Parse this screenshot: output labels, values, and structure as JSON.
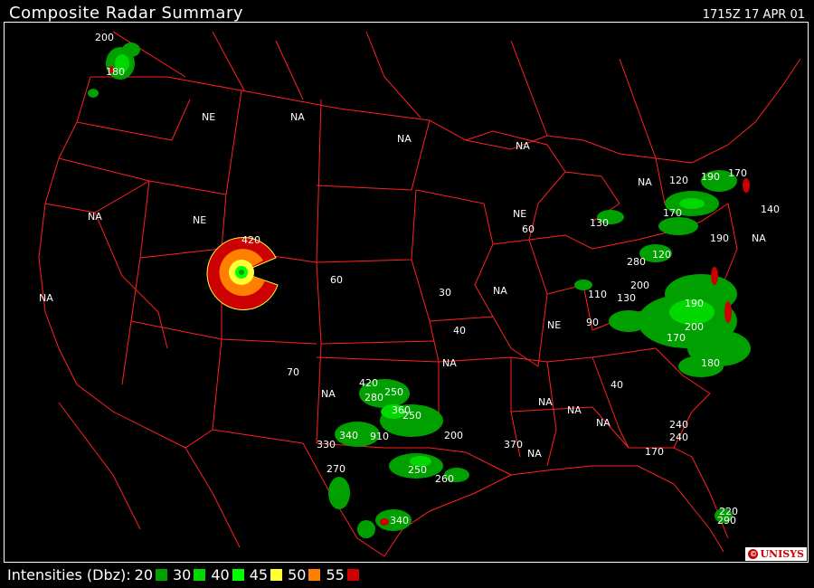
{
  "header": {
    "title": "Composite Radar Summary",
    "timestamp": "1715Z 17 APR 01"
  },
  "legend": {
    "label": "Intensities (Dbz):",
    "items": [
      {
        "value": "20",
        "color": "#00a000"
      },
      {
        "value": "30",
        "color": "#00d800"
      },
      {
        "value": "40",
        "color": "#00ff00"
      },
      {
        "value": "45",
        "color": "#ffff33"
      },
      {
        "value": "50",
        "color": "#ff7f00"
      },
      {
        "value": "55",
        "color": "#cc0000"
      }
    ]
  },
  "logo": {
    "text": "UNISYS",
    "symbol": "©"
  },
  "colors": {
    "background": "#000000",
    "boundaries": "#ff2020",
    "text": "#ffffff"
  },
  "map_labels": [
    "200",
    "180",
    "NE",
    "NA",
    "NA",
    "NE",
    "NA",
    "420",
    "NA",
    "60",
    "NA",
    "NA",
    "30",
    "NA",
    "NE",
    "NE",
    "60",
    "130",
    "120",
    "170",
    "190",
    "170",
    "140",
    "NA",
    "190",
    "280",
    "120",
    "200",
    "110",
    "130",
    "90",
    "190",
    "200",
    "170",
    "180",
    "40",
    "70",
    "NA",
    "420",
    "250",
    "280",
    "360",
    "250",
    "40",
    "NA",
    "NA",
    "NA",
    "NA",
    "200",
    "340",
    "910",
    "330",
    "270",
    "260",
    "250",
    "370",
    "NA",
    "170",
    "240",
    "240",
    "340",
    "220",
    "290"
  ]
}
